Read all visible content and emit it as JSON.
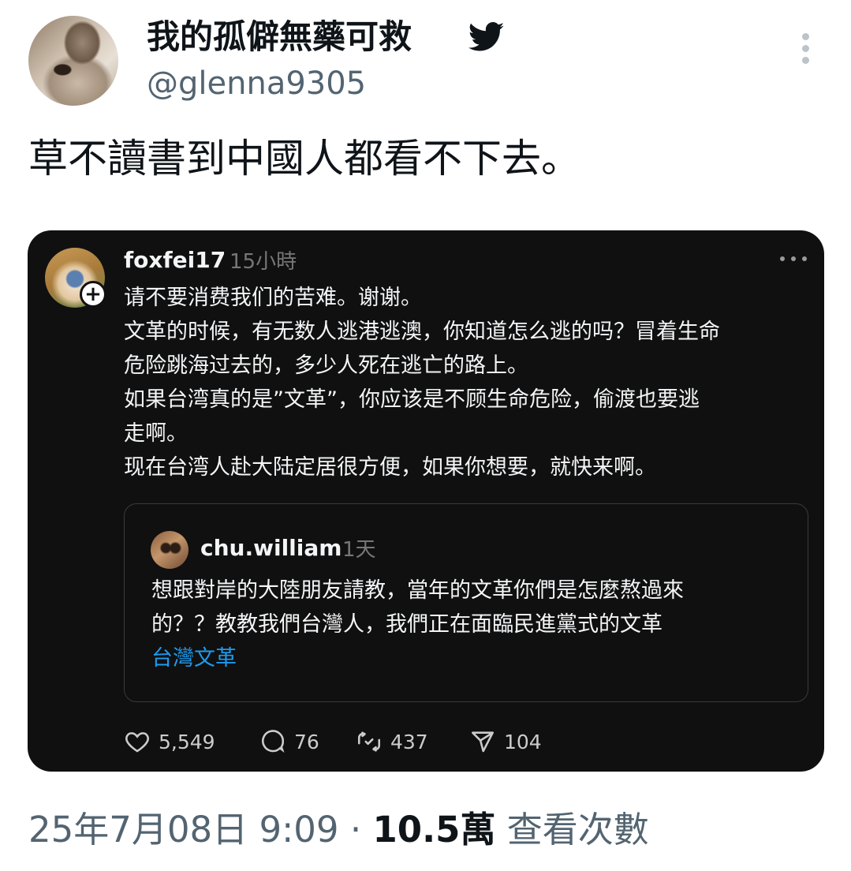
{
  "tweet": {
    "display_name": "我的孤僻無藥可救",
    "handle": "@glenna9305",
    "text": "草不讀書到中國人都看不下去。",
    "date_time": "25年7月08日 9:09",
    "separator": "·",
    "views_count": "10.5萬",
    "views_label": "查看次數",
    "more_icon": "more-vertical-icon",
    "verified_icon": "twitter-bird-icon"
  },
  "embedded_post": {
    "username": "foxfei17",
    "time": "15小時",
    "follow_badge": "+",
    "lines": [
      "请不要消费我们的苦难。谢谢。",
      "文革的时候，有无数人逃港逃澳，你知道怎么逃的吗？冒着生命",
      "危险跳海过去的，多少人死在逃亡的路上。",
      "如果台湾真的是”文革”，你应该是不顾生命危险，偷渡也要逃",
      "走啊。",
      "现在台湾人赴大陆定居很方便，如果你想要，就快来啊。"
    ],
    "quoted": {
      "username": "chu.william",
      "time": "1天",
      "lines": [
        "想跟對岸的大陸朋友請教，當年的文革你們是怎麼熬過來",
        "的？？教教我們台灣人，我們正在面臨民進黨式的文革"
      ],
      "tag": "台灣文革"
    },
    "actions": {
      "likes": "5,549",
      "comments": "76",
      "reposts": "437",
      "shares": "104"
    }
  },
  "colors": {
    "card_background": "#101010",
    "link_blue": "#1d9bf0",
    "secondary_text": "#536471"
  }
}
